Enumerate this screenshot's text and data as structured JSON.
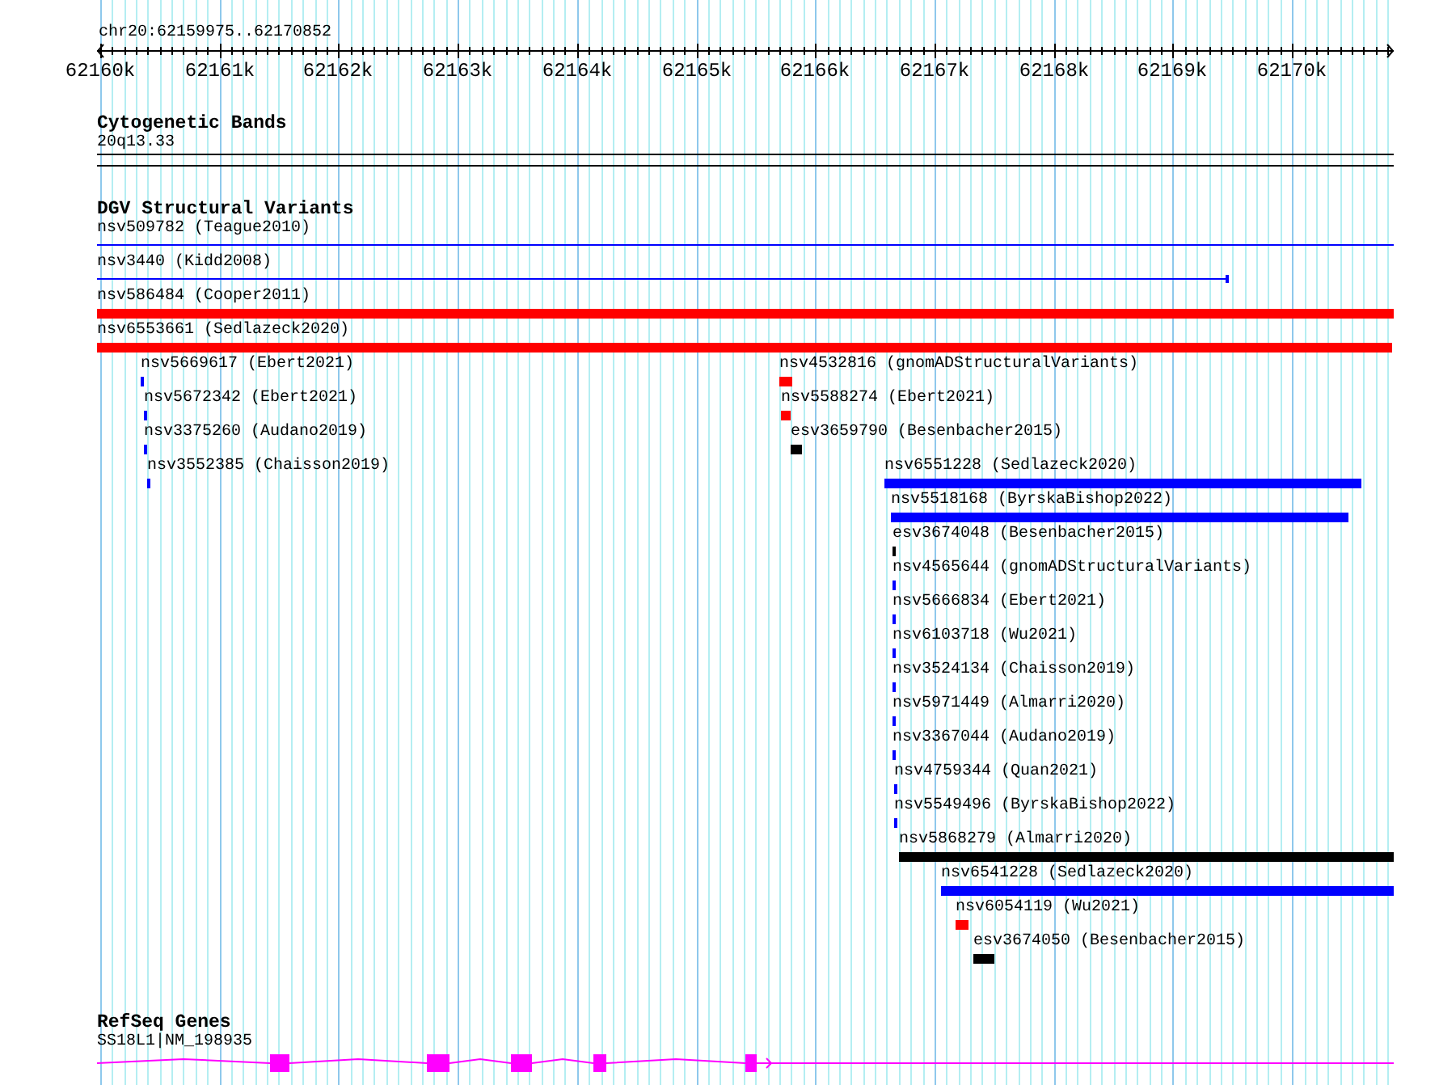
{
  "region": {
    "label": "chr20:62159975..62170852"
  },
  "ruler": {
    "ticks": [
      "62160k",
      "62161k",
      "62162k",
      "62163k",
      "62164k",
      "62165k",
      "62166k",
      "62167k",
      "62168k",
      "62169k",
      "62170k"
    ]
  },
  "tracks": [
    {
      "kind": "cytoband",
      "title": "Cytogenetic Bands",
      "features": [
        {
          "label": "20q13.33"
        }
      ]
    },
    {
      "kind": "variants",
      "title": "DGV Structural Variants",
      "features": [
        {
          "label": "nsv509782 (Teague2010)",
          "color": "#0000ff",
          "kind": "line"
        },
        {
          "label": "nsv3440 (Kidd2008)",
          "color": "#0000ff",
          "kind": "line"
        },
        {
          "label": "nsv586484 (Cooper2011)",
          "color": "#ff0000",
          "kind": "bar"
        },
        {
          "label": "nsv6553661 (Sedlazeck2020)",
          "color": "#ff0000",
          "kind": "bar"
        },
        {
          "label": "nsv5669617 (Ebert2021)",
          "color": "#0000ff",
          "kind": "bar"
        },
        {
          "label": "nsv4532816 (gnomADStructuralVariants)",
          "color": "#ff0000",
          "kind": "bar"
        },
        {
          "label": "nsv5672342 (Ebert2021)",
          "color": "#0000ff",
          "kind": "bar"
        },
        {
          "label": "nsv5588274 (Ebert2021)",
          "color": "#ff0000",
          "kind": "bar"
        },
        {
          "label": "nsv3375260 (Audano2019)",
          "color": "#0000ff",
          "kind": "bar"
        },
        {
          "label": "esv3659790 (Besenbacher2015)",
          "color": "#000000",
          "kind": "bar"
        },
        {
          "label": "nsv3552385 (Chaisson2019)",
          "color": "#0000ff",
          "kind": "bar"
        },
        {
          "label": "nsv6551228 (Sedlazeck2020)",
          "color": "#0000ff",
          "kind": "bar"
        },
        {
          "label": "nsv5518168 (ByrskaBishop2022)",
          "color": "#0000ff",
          "kind": "bar"
        },
        {
          "label": "esv3674048 (Besenbacher2015)",
          "color": "#000000",
          "kind": "bar"
        },
        {
          "label": "nsv4565644 (gnomADStructuralVariants)",
          "color": "#0000ff",
          "kind": "bar"
        },
        {
          "label": "nsv5666834 (Ebert2021)",
          "color": "#0000ff",
          "kind": "bar"
        },
        {
          "label": "nsv6103718 (Wu2021)",
          "color": "#0000ff",
          "kind": "bar"
        },
        {
          "label": "nsv3524134 (Chaisson2019)",
          "color": "#0000ff",
          "kind": "bar"
        },
        {
          "label": "nsv5971449 (Almarri2020)",
          "color": "#0000ff",
          "kind": "bar"
        },
        {
          "label": "nsv3367044 (Audano2019)",
          "color": "#0000ff",
          "kind": "bar"
        },
        {
          "label": "nsv4759344 (Quan2021)",
          "color": "#0000ff",
          "kind": "bar"
        },
        {
          "label": "nsv5549496 (ByrskaBishop2022)",
          "color": "#0000ff",
          "kind": "bar"
        },
        {
          "label": "nsv5868279 (Almarri2020)",
          "color": "#000000",
          "kind": "bar"
        },
        {
          "label": "nsv6541228 (Sedlazeck2020)",
          "color": "#0000ff",
          "kind": "bar"
        },
        {
          "label": "nsv6054119 (Wu2021)",
          "color": "#ff0000",
          "kind": "bar"
        },
        {
          "label": "esv3674050 (Besenbacher2015)",
          "color": "#000000",
          "kind": "bar"
        }
      ]
    },
    {
      "kind": "genes",
      "title": "RefSeq Genes",
      "features": [
        {
          "label": "SS18L1|NM_198935",
          "forward": true
        }
      ]
    }
  ]
}
